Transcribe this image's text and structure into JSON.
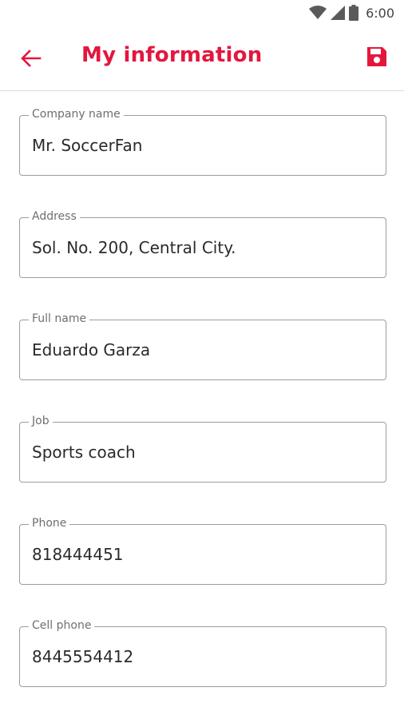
{
  "status_bar": {
    "time": "6:00",
    "icons": [
      "wifi-icon",
      "signal-icon",
      "battery-icon"
    ]
  },
  "header": {
    "title": "My information",
    "back_icon": "arrow-left-icon",
    "save_icon": "floppy-disk-icon",
    "accent_color": "#e3173e"
  },
  "form": {
    "fields": [
      {
        "label": "Company name",
        "value": "Mr. SoccerFan"
      },
      {
        "label": "Address",
        "value": "Sol. No. 200, Central City."
      },
      {
        "label": "Full name",
        "value": "Eduardo Garza"
      },
      {
        "label": "Job",
        "value": "Sports coach"
      },
      {
        "label": "Phone",
        "value": "818444451"
      },
      {
        "label": "Cell phone",
        "value": "8445554412"
      }
    ]
  }
}
